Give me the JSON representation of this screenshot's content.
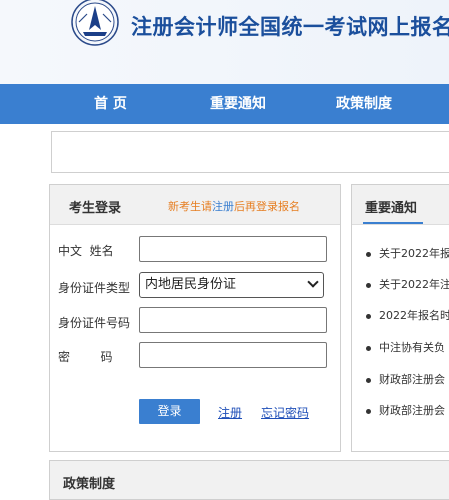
{
  "header": {
    "site_title": "注册会计师全国统一考试网上报名"
  },
  "nav": {
    "items": [
      "首 页",
      "重要通知",
      "政策制度"
    ]
  },
  "login": {
    "title": "考生登录",
    "tip_prefix": "新考生请",
    "tip_register": "注册",
    "tip_suffix": "后再登录报名",
    "fields": {
      "name_label": "中文  姓名",
      "id_type_label": "身份证件类型",
      "id_type_value": "内地居民身份证",
      "id_number_label": "身份证件号码",
      "password_label": "密        码"
    },
    "login_button": "登录",
    "register_link": "注册",
    "forgot_link": "忘记密码"
  },
  "notices": {
    "title": "重要通知",
    "items": [
      "关于2022年​报",
      "关于2022年注",
      "2022年报名时",
      "中注协有关负",
      "财政部注册会",
      "财政部注册会"
    ]
  },
  "policy": {
    "title": "政策制度"
  },
  "colors": {
    "brand_blue": "#3a7fd0",
    "title_blue": "#1b4f9c",
    "tip_orange": "#e67e22",
    "link_blue": "#1f4fb8"
  }
}
